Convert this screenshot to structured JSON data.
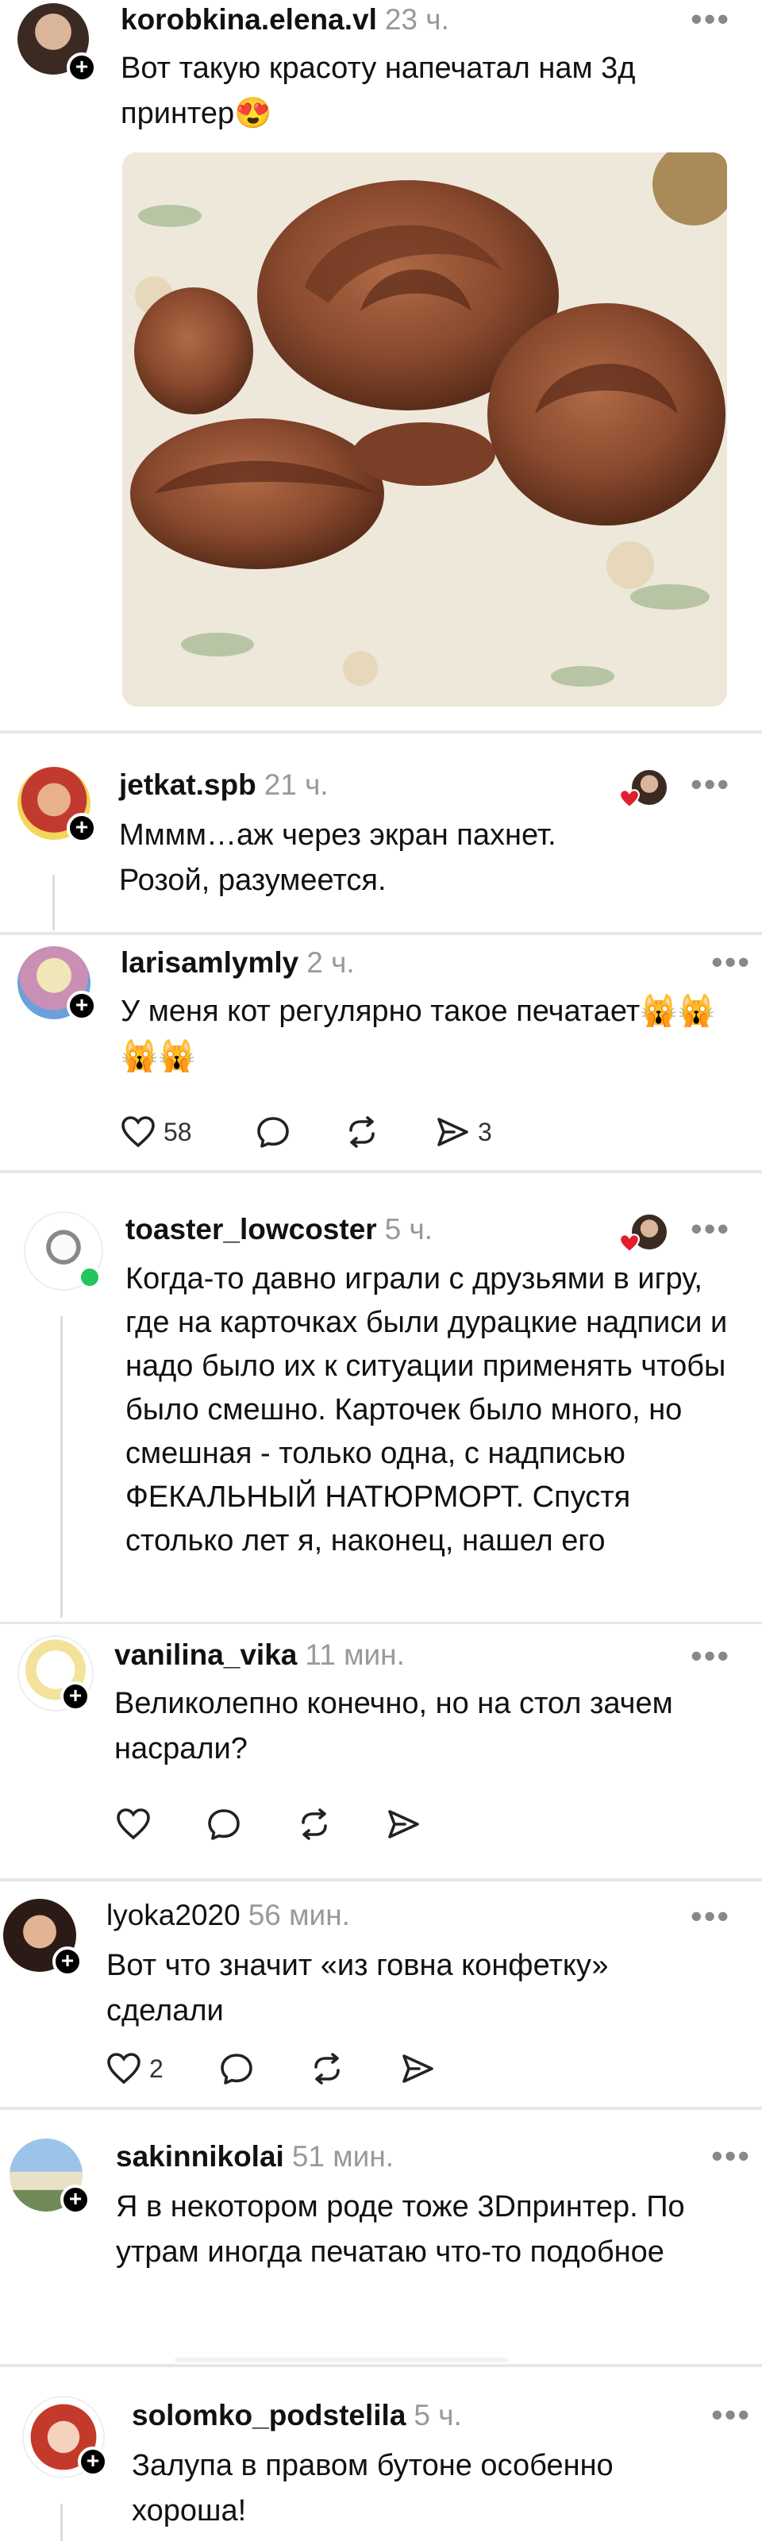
{
  "posts": [
    {
      "username": "korobkina.elena.vl",
      "time": "23 ч.",
      "text": "Вот такую красоту напечатал нам 3д принтер😍"
    },
    {
      "username": "jetkat.spb",
      "time": "21 ч.",
      "text": "Мммм…аж через экран пахнет. Розой, разумеется."
    },
    {
      "username": "larisamlymly",
      "time": "2 ч.",
      "text": "У меня кот регулярно такое печатает🙀🙀🙀🙀",
      "likes": "58",
      "reposts": "3"
    },
    {
      "username": "toaster_lowcoster",
      "time": "5 ч.",
      "text": "Когда-то давно играли с друзьями в игру, где на карточках были дурацкие надписи и надо было их к ситуации применять чтобы было смешно. Карточек было много, но смешная - только одна, с надписью ФЕКАЛЬНЫЙ НАТЮРМОРТ. Спустя столько лет я, наконец, нашел его"
    },
    {
      "username": "vanilina_vika",
      "time": "11 мин.",
      "text": "Великолепно конечно, но на стол зачем насрали?"
    },
    {
      "username": "lyoka2020",
      "time": "56 мин.",
      "text": "Вот что значит «из говна конфетку» сделали",
      "likes": "2"
    },
    {
      "username": "sakinnikolai",
      "time": "51 мин.",
      "text": "Я в некотором роде тоже 3Dпринтер. По утрам иногда печатаю что-то подобное"
    },
    {
      "username": "solomko_podstelila",
      "time": "5 ч.",
      "text": "Залупа в правом бутоне особенно хороша!"
    }
  ],
  "icons": {
    "more": "more-dots-icon",
    "like": "heart-icon",
    "comment": "comment-bubble-icon",
    "repost": "repost-icon",
    "share": "share-send-icon",
    "follow": "plus-icon"
  },
  "colors": {
    "time": "#999999",
    "separator": "#e7e7e7",
    "online": "#22c55e",
    "heart_badge": "#e11d2e"
  }
}
